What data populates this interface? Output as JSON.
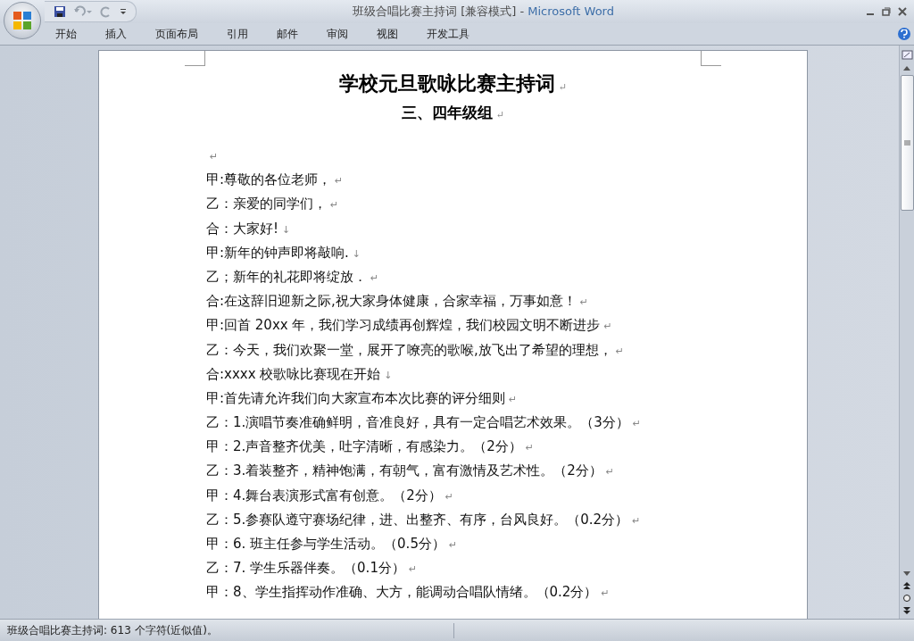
{
  "window": {
    "title": "班级合唱比赛主持词 [兼容模式] - ",
    "app": "Microsoft Word"
  },
  "ribbon_tabs": [
    {
      "label": "开始",
      "selected": false
    },
    {
      "label": "插入",
      "selected": false
    },
    {
      "label": "页面布局",
      "selected": false
    },
    {
      "label": "引用",
      "selected": false
    },
    {
      "label": "邮件",
      "selected": false
    },
    {
      "label": "审阅",
      "selected": false
    },
    {
      "label": "视图",
      "selected": false
    },
    {
      "label": "开发工具",
      "selected": false
    }
  ],
  "document": {
    "title": "学校元旦歌咏比赛主持词",
    "title_mark": "↵",
    "subtitle": "三、四年级组",
    "subtitle_mark": "↵",
    "lines": [
      {
        "mark": "↵"
      },
      {
        "text": "甲:尊敬的各位老师，",
        "mark": "↵"
      },
      {
        "text": "乙：亲爱的同学们，",
        "mark": "↵"
      },
      {
        "text": "合：大家好!",
        "mark": "↓"
      },
      {
        "text": "甲:新年的钟声即将敲响.",
        "mark": "↓"
      },
      {
        "text": "乙；新年的礼花即将绽放．",
        "mark": "↵"
      },
      {
        "text": "合:在这辞旧迎新之际,祝大家身体健康，合家幸福，万事如意！",
        "mark": "↵"
      },
      {
        "text": "甲:回首 20xx 年，我们学习成绩再创辉煌，我们校园文明不断进步",
        "mark": "↵"
      },
      {
        "text": "乙：今天，我们欢聚一堂，展开了嘹亮的歌喉,放飞出了希望的理想，",
        "mark": "↵"
      },
      {
        "text": "合:xxxx 校歌咏比赛现在开始",
        "mark": "↓"
      },
      {
        "text": "甲:首先请允许我们向大家宣布本次比赛的评分细则",
        "mark": "↵"
      },
      {
        "text": "乙：1.演唱节奏准确鲜明，音准良好，具有一定合唱艺术效果。（3分）",
        "mark": "↵"
      },
      {
        "text": "甲：2.声音整齐优美，吐字清晰，有感染力。（2分）",
        "mark": "↵"
      },
      {
        "text": "乙：3.着装整齐，精神饱满，有朝气，富有激情及艺术性。（2分）",
        "mark": "↵"
      },
      {
        "text": "甲：4.舞台表演形式富有创意。（2分）",
        "mark": "↵"
      },
      {
        "text": "乙：5.参赛队遵守赛场纪律，进、出整齐、有序，台风良好。（0.2分）",
        "mark": "↵"
      },
      {
        "text": "甲：6. 班主任参与学生活动。（0.5分）",
        "mark": "↵"
      },
      {
        "text": "乙：7. 学生乐器伴奏。（0.1分）",
        "mark": "↵"
      },
      {
        "text": "甲：8、学生指挥动作准确、大方，能调动合唱队情绪。（0.2分）",
        "mark": "↵"
      }
    ]
  },
  "status_bar": {
    "text": "班级合唱比赛主持词: 613 个字符(近似值)。"
  }
}
